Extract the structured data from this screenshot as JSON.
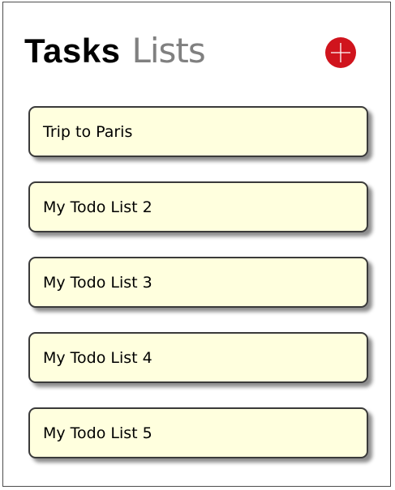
{
  "header": {
    "title_strong": "Tasks",
    "title_light": "Lists",
    "add_icon": "plus-circle-icon",
    "add_color": "#d0141d"
  },
  "lists": [
    {
      "label": "Trip to Paris"
    },
    {
      "label": "My Todo List 2"
    },
    {
      "label": "My Todo List 3"
    },
    {
      "label": "My Todo List 4"
    },
    {
      "label": "My Todo List 5"
    }
  ],
  "colors": {
    "card_background": "#ffffde",
    "card_border": "#3a3a3a",
    "title_light": "#808080"
  }
}
